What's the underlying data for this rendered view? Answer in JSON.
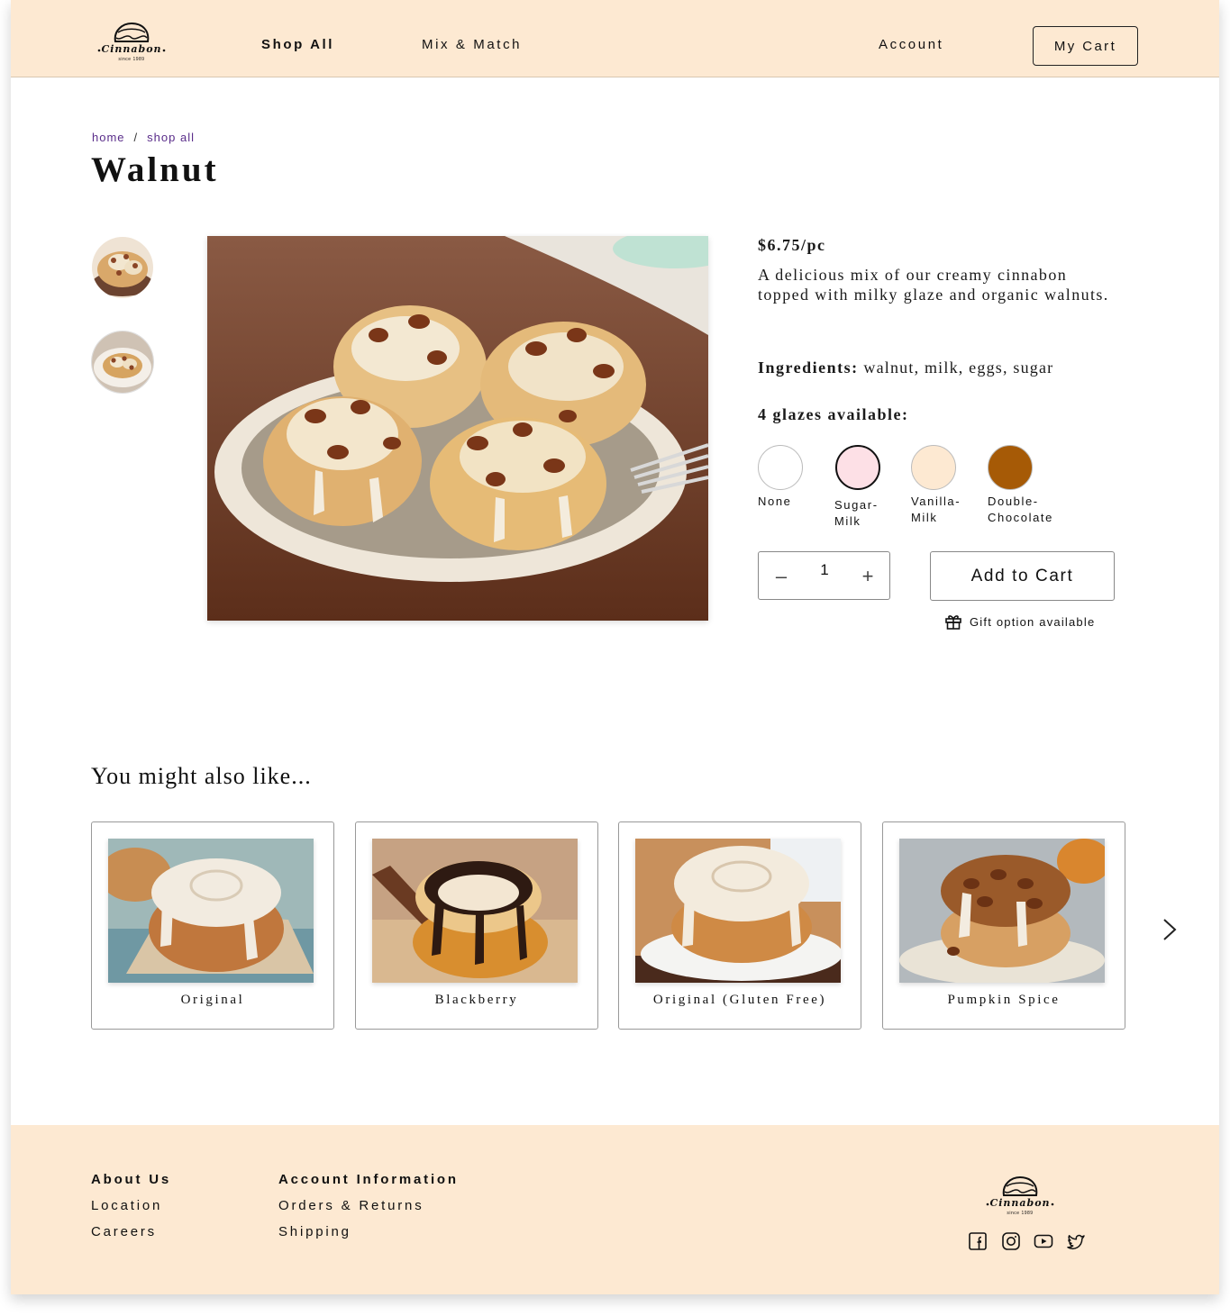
{
  "brand": {
    "name": "Cinnabon",
    "since": "since 1989"
  },
  "nav": {
    "shop_all": "Shop All",
    "mix_match": "Mix & Match",
    "account": "Account",
    "cart": "My Cart"
  },
  "breadcrumb": {
    "home": "home",
    "separator": "/",
    "shop_all": "shop all"
  },
  "product": {
    "title": "Walnut",
    "price": "$6.75/pc",
    "description": "A delicious mix of our creamy cinnabon topped with milky glaze and organic walnuts.",
    "ingredients_label": "Ingredients:",
    "ingredients": "walnut, milk, eggs, sugar",
    "glazes_title": "4 glazes available:",
    "glazes": [
      {
        "label": "None",
        "color": "#ffffff",
        "selected": false
      },
      {
        "label": "Sugar-Milk",
        "color": "#fde0e6",
        "selected": true
      },
      {
        "label": "Vanilla-Milk",
        "color": "#fde9d2",
        "selected": false
      },
      {
        "label": "Double-Chocolate",
        "color": "#a65a06",
        "selected": false
      }
    ],
    "quantity": "1",
    "minus": "–",
    "plus": "+",
    "add_to_cart": "Add to Cart",
    "gift_option": "Gift option available"
  },
  "recommendations": {
    "title": "You might also like...",
    "items": [
      {
        "label": "Original"
      },
      {
        "label": "Blackberry"
      },
      {
        "label": "Original (Gluten Free)"
      },
      {
        "label": "Pumpkin Spice"
      }
    ]
  },
  "footer": {
    "about_heading": "About Us",
    "about_links": [
      "Location",
      "Careers"
    ],
    "account_heading": "Account Information",
    "account_links": [
      "Orders & Returns",
      "Shipping"
    ],
    "social_icons": [
      "facebook-icon",
      "instagram-icon",
      "youtube-icon",
      "twitter-icon"
    ]
  },
  "colors": {
    "header_bg": "#fde9d2",
    "breadcrumb": "#5a2d8a",
    "text": "#111111"
  }
}
